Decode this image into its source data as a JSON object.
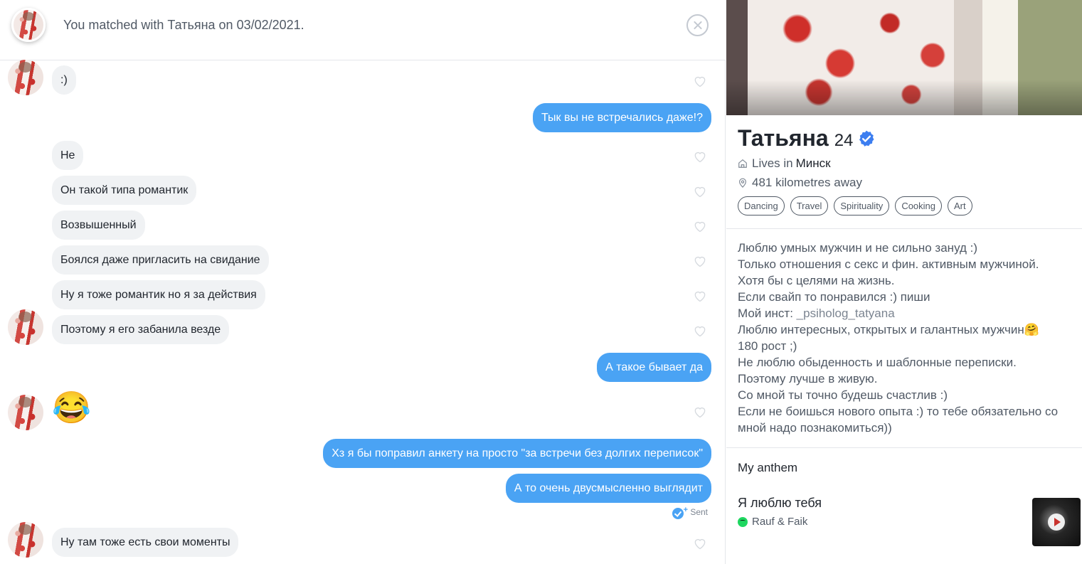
{
  "header": {
    "match_text": "You matched with Татьяна on 03/02/2021.",
    "close_icon": "close-circle-icon"
  },
  "messages": [
    {
      "dir": "in",
      "text": ":)"
    },
    {
      "dir": "out",
      "text": "Тык вы не встречались даже!?"
    },
    {
      "dir": "in",
      "text": "Не"
    },
    {
      "dir": "in",
      "text": "Он такой типа романтик"
    },
    {
      "dir": "in",
      "text": "Возвышенный"
    },
    {
      "dir": "in",
      "text": "Боялся даже пригласить на свидание"
    },
    {
      "dir": "in",
      "text": "Ну я тоже романтик но я за действия"
    },
    {
      "dir": "in",
      "text": "Поэтому я его забанила везде"
    },
    {
      "dir": "out",
      "text": "А такое бывает да"
    },
    {
      "dir": "in",
      "text": "😂"
    },
    {
      "dir": "out",
      "text": "Хз я бы поправил анкету на просто \"за встречи без долгих переписок\""
    },
    {
      "dir": "out",
      "text": "А то очень двусмысленно выглядит"
    },
    {
      "dir": "in",
      "text": "Ну там тоже есть свои моменты"
    }
  ],
  "sent_status": "Sent",
  "profile": {
    "name": "Татьяна",
    "age": "24",
    "lives_prefix": "Lives in",
    "city": "Минск",
    "distance": "481 kilometres away",
    "tags": [
      "Dancing",
      "Travel",
      "Spirituality",
      "Cooking",
      "Art"
    ],
    "bio_lines": [
      "Люблю умных мужчин и не сильно зануд :)",
      "Только отношения с секс и фин. активным мужчиной.",
      "Хотя бы с целями на жизнь.",
      "Если свайп то понравился :) пиши",
      "Мой инст: ",
      "Люблю интересных, открытых и галантных мужчин🤗",
      "180 рост ;)",
      "Не люблю обыденность и шаблонные переписки.",
      "Поэтому лучше в живую.",
      "Со мной ты точно будешь счастлив :)",
      "Если не боишься нового опыта :) то тебе обязательно со мной надо познакомиться))"
    ],
    "insta_handle": "_psiholog_tatyana",
    "anthem_title": "My anthem",
    "song_title": "Я люблю тебя",
    "song_artist": "Rauf & Faik"
  },
  "colors": {
    "accent_blue": "#4aa3f4",
    "bubble_in": "#f0f2f4",
    "text_dark": "#21262e",
    "text_muted": "#505965",
    "spotify_green": "#1ed760"
  }
}
